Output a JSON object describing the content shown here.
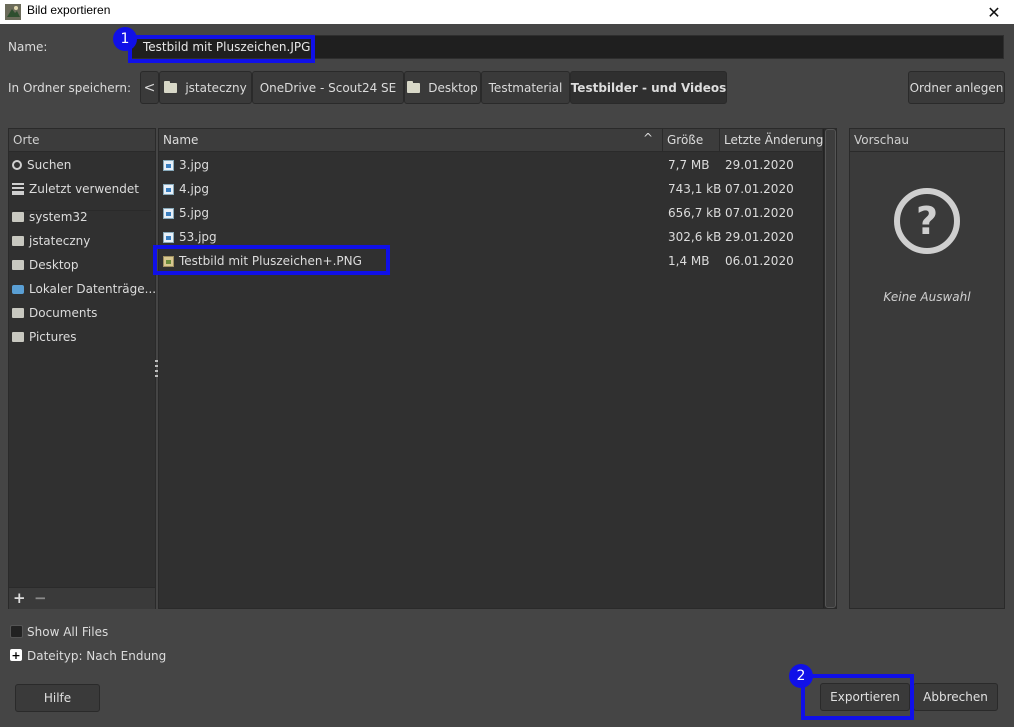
{
  "window": {
    "title": "Bild exportieren",
    "close_glyph": "✕"
  },
  "name_row": {
    "label": "Name:",
    "value": "Testbild mit Pluszeichen.JPG"
  },
  "folder_row": {
    "label": "In Ordner speichern:",
    "back_glyph": "<",
    "breadcrumbs": [
      "jstateczny",
      "OneDrive - Scout24 SE",
      "Desktop",
      "Testmaterial",
      "Testbilder - und Videos"
    ],
    "new_folder_label": "Ordner anlegen"
  },
  "places": {
    "header": "Orte",
    "items": [
      {
        "label": "Suchen",
        "icon": "search-icon"
      },
      {
        "label": "Zuletzt verwendet",
        "icon": "recent-icon"
      },
      {
        "label": "system32",
        "icon": "folder-icon"
      },
      {
        "label": "jstateczny",
        "icon": "folder-icon"
      },
      {
        "label": "Desktop",
        "icon": "folder-icon"
      },
      {
        "label": "Lokaler Datenträge...",
        "icon": "drive-icon"
      },
      {
        "label": "Documents",
        "icon": "folder-icon"
      },
      {
        "label": "Pictures",
        "icon": "folder-icon"
      }
    ],
    "add_glyph": "+",
    "remove_glyph": "−"
  },
  "files": {
    "columns": {
      "name": "Name",
      "size": "Größe",
      "date": "Letzte Änderung"
    },
    "sort_glyph": "^",
    "rows": [
      {
        "name": "3.jpg",
        "size": "7,7 MB",
        "date": "29.01.2020"
      },
      {
        "name": "4.jpg",
        "size": "743,1 kB",
        "date": "07.01.2020"
      },
      {
        "name": "5.jpg",
        "size": "656,7 kB",
        "date": "07.01.2020"
      },
      {
        "name": "53.jpg",
        "size": "302,6 kB",
        "date": "29.01.2020"
      },
      {
        "name": "Testbild mit Pluszeichen+.PNG",
        "size": "1,4 MB",
        "date": "06.01.2020"
      }
    ]
  },
  "preview": {
    "header": "Vorschau",
    "icon_glyph": "?",
    "empty_text": "Keine Auswahl"
  },
  "options": {
    "show_all_files": "Show All Files",
    "filetype_expander_glyph": "+",
    "filetype": "Dateityp: Nach Endung"
  },
  "buttons": {
    "help": "Hilfe",
    "export": "Exportieren",
    "cancel": "Abbrechen"
  },
  "annotations": {
    "badge_1": "1",
    "badge_2": "2",
    "highlight_color": "#1010e8"
  }
}
